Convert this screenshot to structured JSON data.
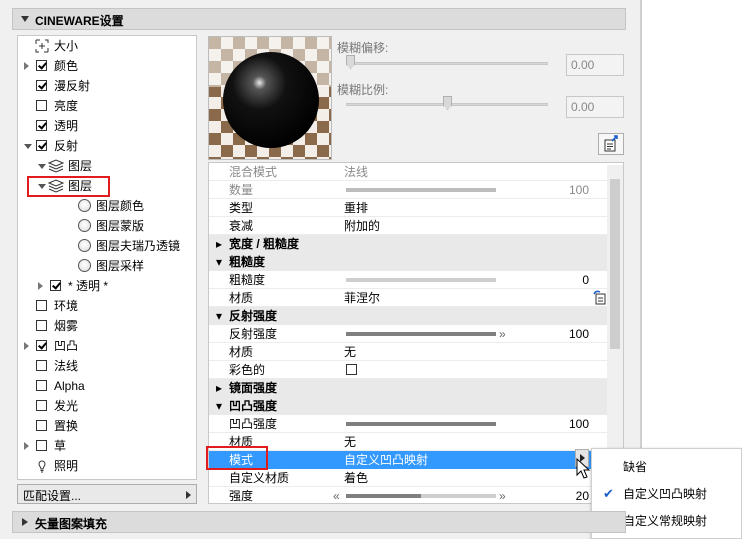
{
  "panel": {
    "title": "CINEWARE设置",
    "footer_title": "矢量图案填充"
  },
  "tree": {
    "items": [
      {
        "label": "大小",
        "expander": "none",
        "control": "icon-size"
      },
      {
        "label": "颜色",
        "expander": "right",
        "control": "checked"
      },
      {
        "label": "漫反射",
        "expander": "none",
        "control": "checked"
      },
      {
        "label": "亮度",
        "expander": "none",
        "control": "unchecked"
      },
      {
        "label": "透明",
        "expander": "none",
        "control": "checked"
      },
      {
        "label": "反射",
        "expander": "down",
        "control": "checked"
      },
      {
        "label": "图层",
        "expander": "down",
        "control": "layers-icon"
      },
      {
        "label": "图层",
        "expander": "down",
        "control": "layers-icon"
      },
      {
        "label": "图层颜色",
        "expander": "none",
        "control": "radio"
      },
      {
        "label": "图层蒙版",
        "expander": "none",
        "control": "radio"
      },
      {
        "label": "图层夫瑞乃透镜",
        "expander": "none",
        "control": "radio"
      },
      {
        "label": "图层采样",
        "expander": "none",
        "control": "radio"
      },
      {
        "label": "* 透明 *",
        "expander": "right",
        "control": "checked"
      },
      {
        "label": "环境",
        "expander": "none",
        "control": "unchecked"
      },
      {
        "label": "烟雾",
        "expander": "none",
        "control": "unchecked"
      },
      {
        "label": "凹凸",
        "expander": "right",
        "control": "checked"
      },
      {
        "label": "法线",
        "expander": "none",
        "control": "unchecked"
      },
      {
        "label": "Alpha",
        "expander": "none",
        "control": "unchecked"
      },
      {
        "label": "发光",
        "expander": "none",
        "control": "unchecked"
      },
      {
        "label": "置换",
        "expander": "none",
        "control": "unchecked"
      },
      {
        "label": "草",
        "expander": "right",
        "control": "unchecked"
      },
      {
        "label": "照明",
        "expander": "none",
        "control": "lightbulb-icon"
      }
    ],
    "match_settings": "匹配设置..."
  },
  "blur": {
    "offset_label": "模糊偏移:",
    "offset_value": "0.00",
    "offset_level": 0,
    "scale_label": "模糊比例:",
    "scale_value": "0.00",
    "scale_level": 0.5
  },
  "properties": {
    "rows": [
      {
        "type": "row",
        "key": "混合模式",
        "value": "法线",
        "dim": true
      },
      {
        "type": "slider",
        "key": "数量",
        "num": "100",
        "level": 1.0,
        "dim": true
      },
      {
        "type": "row",
        "key": "类型",
        "value": "重排"
      },
      {
        "type": "row",
        "key": "衰减",
        "value": "附加的"
      },
      {
        "type": "section",
        "key": "宽度 / 粗糙度",
        "open": false
      },
      {
        "type": "section",
        "key": "粗糙度",
        "open": true
      },
      {
        "type": "slider",
        "key": "粗糙度",
        "num": "0",
        "level": 0.0
      },
      {
        "type": "row",
        "key": "材质",
        "value": "菲涅尔",
        "icon": true
      },
      {
        "type": "section",
        "key": "反射强度",
        "open": true
      },
      {
        "type": "slider",
        "key": "反射强度",
        "num": "100",
        "level": 1.0,
        "arrows": "right"
      },
      {
        "type": "row",
        "key": "材质",
        "value": "无"
      },
      {
        "type": "check",
        "key": "彩色的",
        "checked": false
      },
      {
        "type": "section",
        "key": "镜面强度",
        "open": false
      },
      {
        "type": "section",
        "key": "凹凸强度",
        "open": true
      },
      {
        "type": "slider",
        "key": "凹凸强度",
        "num": "100",
        "level": 1.0
      },
      {
        "type": "row",
        "key": "材质",
        "value": "无"
      },
      {
        "type": "row",
        "key": "模式",
        "value": "自定义凹凸映射",
        "highlight": true
      },
      {
        "type": "row",
        "key": "自定义材质",
        "value": "着色"
      },
      {
        "type": "slider",
        "key": "强度",
        "num": "20",
        "level": 0.5,
        "arrows": "both"
      }
    ]
  },
  "mode_menu": {
    "items": [
      {
        "label": "缺省",
        "checked": false
      },
      {
        "label": "自定义凹凸映射",
        "checked": true
      },
      {
        "label": "自定义常规映射",
        "checked": false
      }
    ]
  },
  "colors": {
    "highlight": "#3399ff",
    "annotation": "#e01c1c",
    "panel": "#f0f0f0"
  }
}
